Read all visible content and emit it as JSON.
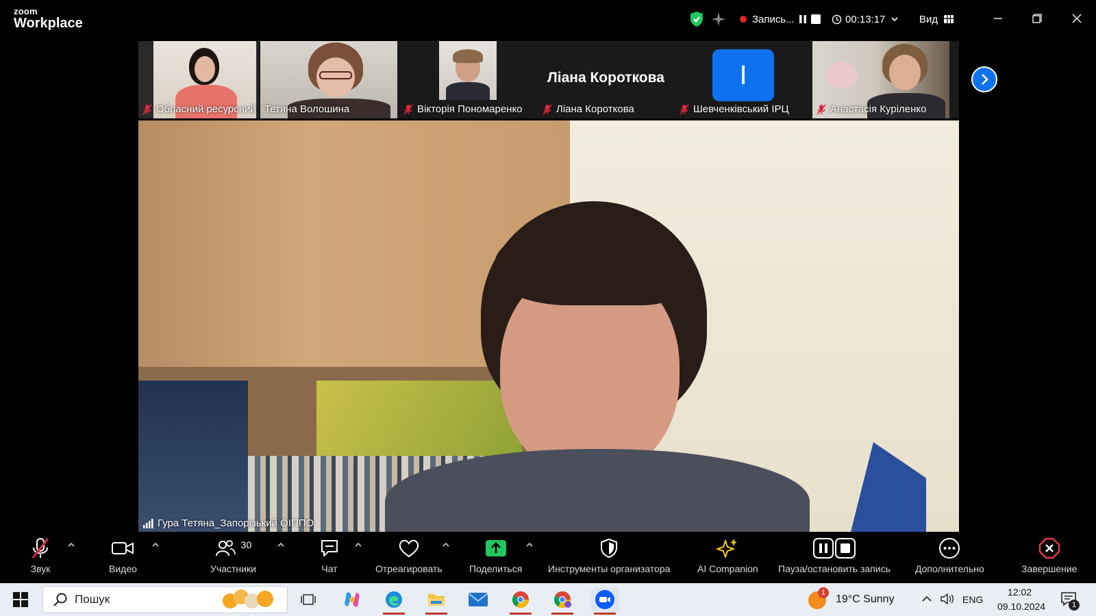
{
  "window": {
    "logo_line1": "zoom",
    "logo_line2": "Workplace",
    "recording_label": "Запись...",
    "timer": "00:13:17",
    "view_label": "Вид"
  },
  "participants_strip": [
    {
      "name": "Обласний ресурсний ...",
      "muted": true
    },
    {
      "name": "Тетяна Волошина",
      "muted": false
    },
    {
      "name": "Вікторія Пономаренко",
      "muted": true
    },
    {
      "name": "Ліана Короткова",
      "muted": true,
      "center_text": "Ліана Короткова"
    },
    {
      "name": "Шевченківський ІРЦ",
      "muted": true,
      "avatar_letter": "І"
    },
    {
      "name": "Анастасія Куріленко",
      "muted": true
    }
  ],
  "main_video": {
    "speaker_name": "Гура Тетяна_Запорізький ОІППО"
  },
  "toolbar": {
    "audio": "Звук",
    "video": "Видео",
    "participants": "Участники",
    "participants_count": "30",
    "chat": "Чат",
    "react": "Отреагировать",
    "share": "Поделиться",
    "host_tools": "Инструменты организатора",
    "ai_companion": "AI Companion",
    "pause_record": "Пауза/остановить запись",
    "more": "Дополнительно",
    "end": "Завершение"
  },
  "taskbar": {
    "search_placeholder": "Пошук",
    "weather_badge": "1",
    "weather": "19°C  Sunny",
    "lang": "ENG",
    "time": "12:02",
    "date": "09.10.2024",
    "notif_count": "1"
  },
  "colors": {
    "accent_blue": "#0e72ed",
    "record_red": "#e02828",
    "share_green": "#22c55e",
    "end_red": "#e8384f",
    "mute_red": "#e0263a"
  }
}
